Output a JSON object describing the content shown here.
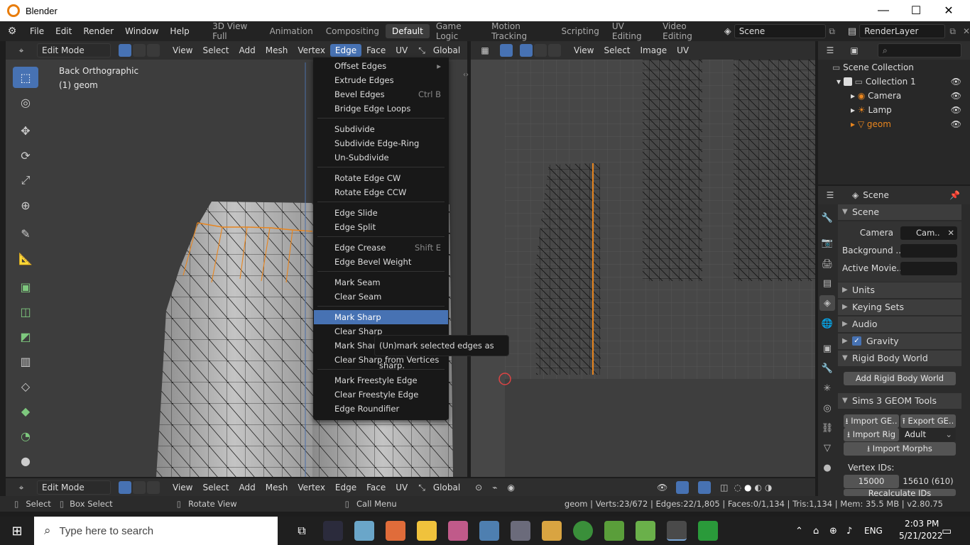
{
  "window": {
    "title": "Blender"
  },
  "menu": [
    "File",
    "Edit",
    "Render",
    "Window",
    "Help"
  ],
  "workspaces": [
    "3D View Full",
    "Animation",
    "Compositing",
    "Default",
    "Game Logic",
    "Motion Tracking",
    "Scripting",
    "UV Editing",
    "Video Editing"
  ],
  "active_workspace": "Default",
  "scene_field": "Scene",
  "renderlayer_field": "RenderLayer",
  "viewport": {
    "mode": "Edit Mode",
    "menus": [
      "View",
      "Select",
      "Add",
      "Mesh",
      "Vertex",
      "Edge",
      "Face",
      "UV"
    ],
    "orientation": "Global",
    "overlay_view": "Back Orthographic",
    "overlay_obj": "(1) geom"
  },
  "uv_editor": {
    "menus": [
      "View",
      "Select",
      "Image",
      "UV"
    ]
  },
  "edge_menu": {
    "items": [
      {
        "label": "Offset Edges",
        "shortcut": "",
        "sub": true
      },
      {
        "label": "Extrude Edges",
        "shortcut": ""
      },
      {
        "label": "Bevel Edges",
        "shortcut": "Ctrl B"
      },
      {
        "label": "Bridge Edge Loops",
        "shortcut": ""
      },
      {
        "label": "Subdivide",
        "shortcut": ""
      },
      {
        "label": "Subdivide Edge-Ring",
        "shortcut": ""
      },
      {
        "label": "Un-Subdivide",
        "shortcut": ""
      },
      {
        "label": "Rotate Edge CW",
        "shortcut": ""
      },
      {
        "label": "Rotate Edge CCW",
        "shortcut": ""
      },
      {
        "label": "Edge Slide",
        "shortcut": ""
      },
      {
        "label": "Edge Split",
        "shortcut": ""
      },
      {
        "label": "Edge Crease",
        "shortcut": "Shift E"
      },
      {
        "label": "Edge Bevel Weight",
        "shortcut": ""
      },
      {
        "label": "Mark Seam",
        "shortcut": ""
      },
      {
        "label": "Clear Seam",
        "shortcut": ""
      },
      {
        "label": "Mark Sharp",
        "shortcut": "",
        "highlighted": true
      },
      {
        "label": "Clear Sharp",
        "shortcut": ""
      },
      {
        "label": "Mark Sharp from Vertices",
        "shortcut": ""
      },
      {
        "label": "Clear Sharp from Vertices",
        "shortcut": ""
      },
      {
        "label": "Mark Freestyle Edge",
        "shortcut": ""
      },
      {
        "label": "Clear Freestyle Edge",
        "shortcut": ""
      },
      {
        "label": "Edge Roundifier",
        "shortcut": ""
      }
    ],
    "tooltip": "(Un)mark selected edges as sharp."
  },
  "outliner": {
    "root": "Scene Collection",
    "collection": "Collection 1",
    "objects": [
      "Camera",
      "Lamp",
      "geom"
    ]
  },
  "properties": {
    "context": "Scene",
    "scene_section": "Scene",
    "camera_label": "Camera",
    "camera_value": "Cam..",
    "background_label": "Background ..",
    "active_movie_label": "Active Movie..",
    "sections": [
      "Units",
      "Keying Sets",
      "Audio",
      "Gravity"
    ],
    "rigid_body": "Rigid Body World",
    "add_rigid": "Add Rigid Body World",
    "sims_section": "Sims 3 GEOM Tools",
    "import_geom": "Import GE..",
    "export_geom": "Export GE..",
    "import_rig": "Import Rig",
    "rig_select": "Adult",
    "import_morphs": "Import Morphs",
    "vertex_ids_label": "Vertex IDs:",
    "vertex_id_a": "15000",
    "vertex_id_b": "15610 (610)",
    "recalc": "Recalculate IDs"
  },
  "status": {
    "select": "Select",
    "box_select": "Box Select",
    "rotate_view": "Rotate View",
    "call_menu": "Call Menu",
    "stats": "geom | Verts:23/672 | Edges:22/1,805 | Faces:0/1,134 | Tris:1,134 | Mem: 35.5 MB | v2.80.75"
  },
  "taskbar": {
    "search_placeholder": "Type here to search",
    "lang": "ENG",
    "time": "2:03 PM",
    "date": "5/21/2022"
  },
  "colors": {
    "accent": "#4772b3",
    "selected_edge": "#e8851e",
    "mesh_fill": "#b9b9b9"
  }
}
